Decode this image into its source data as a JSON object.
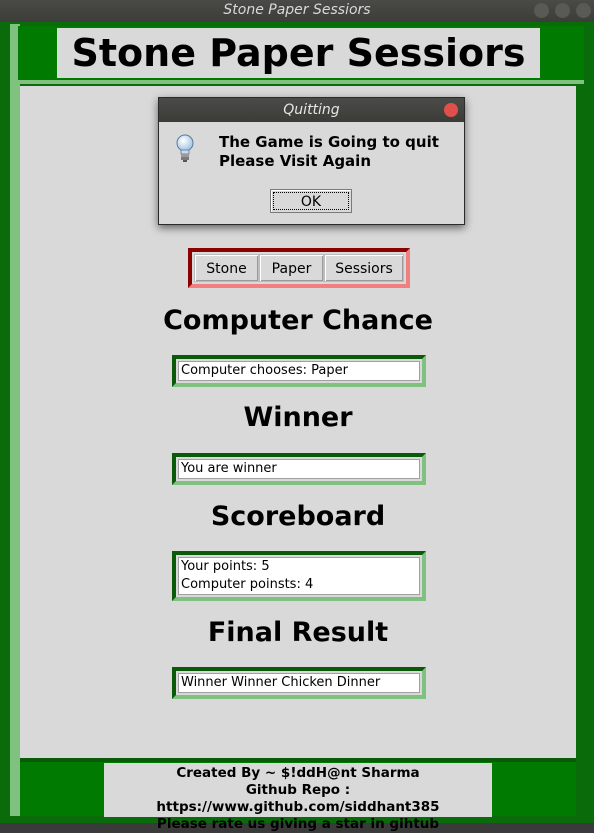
{
  "window": {
    "title": "Stone Paper Sessiors",
    "buttons": [
      "minimize",
      "maximize",
      "close"
    ]
  },
  "header": {
    "title": "Stone Paper Sessiors"
  },
  "choices": {
    "stone": "Stone",
    "paper": "Paper",
    "sessiors": "Sessiors"
  },
  "sections": {
    "computer_chance": {
      "heading": "Computer Chance",
      "value": "Computer chooses: Paper"
    },
    "winner": {
      "heading": "Winner",
      "value": "You are winner"
    },
    "scoreboard": {
      "heading": "Scoreboard",
      "line1": "Your points: 5",
      "line2": "Computer poinsts: 4"
    },
    "final_result": {
      "heading": "Final Result",
      "value": "Winner Winner Chicken Dinner"
    }
  },
  "footer": {
    "line1": "Created By ~ $!ddH@nt Sharma",
    "line2": "Github Repo : https://www.github.com/siddhant385",
    "line3": "Please rate us giving a star in gihtub"
  },
  "dialog": {
    "title": "Quitting",
    "icon": "lightbulb-icon",
    "line1": "The Game is Going to quit",
    "line2": "Please Visit Again",
    "ok_label": "OK"
  },
  "colors": {
    "frame_green": "#0a6b0a",
    "light_green": "#7fc17f",
    "dark_red": "#8b0000",
    "light_red": "#f08080",
    "panel_gray": "#d9d9d9"
  }
}
